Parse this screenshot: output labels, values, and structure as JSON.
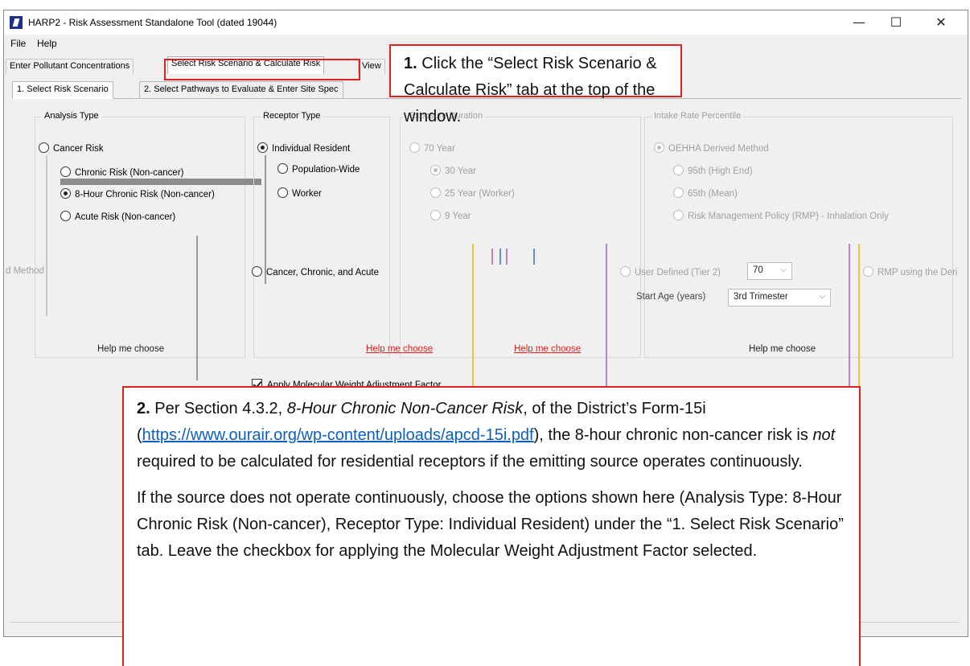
{
  "window": {
    "title": "HARP2 - Risk Assessment Standalone Tool (dated 19044)",
    "minimize": "—",
    "maximize": "☐",
    "close": "✕"
  },
  "menu": [
    "File",
    "Help"
  ],
  "tabs": {
    "enter_pollutant": "Enter Pollutant Concentrations",
    "select_risk": "Select Risk Scenario & Calculate Risk",
    "view": "View"
  },
  "subtabs": {
    "scenario": "1. Select Risk Scenario",
    "pathways": "2. Select Pathways to Evaluate & Enter Site Spec"
  },
  "analysis_type": {
    "title": "Analysis Type",
    "cancer": "Cancer Risk",
    "chronic": "Chronic Risk (Non-cancer)",
    "eight_hour": "8-Hour Chronic Risk (Non-cancer)",
    "acute": "Acute Risk (Non-cancer)",
    "combined": "Cancer, Chronic, and Acute",
    "help": "Help me choose",
    "selected": "8-Hour Chronic Risk (Non-cancer)"
  },
  "receptor_type": {
    "title": "Receptor Type",
    "individual": "Individual Resident",
    "population": "Population-Wide",
    "worker": "Worker",
    "help": "Help me choose",
    "selected": "Individual Resident"
  },
  "exposure_duration": {
    "title": "Exposure Duration",
    "y70": "70 Year",
    "y30": "30 Year",
    "y25": "25 Year (Worker)",
    "y9": "9 Year",
    "help": "Help me choose"
  },
  "intake_rate": {
    "title": "Intake Rate Percentile",
    "oehha": "OEHHA Derived Method",
    "p95": "95th (High End)",
    "p65": "65th (Mean)",
    "rmp": "Risk Management Policy (RMP) - Inhalation Only",
    "user_defined": "User Defined (Tier 2)",
    "user_defined_value": "70",
    "start_age_label": "Start Age (years)",
    "start_age_value": "3rd Trimester",
    "help": "Help me choose",
    "left_fragment": "d Method",
    "rmp_derived": "RMP using the Deri"
  },
  "mwaf": {
    "label": "Apply Molecular Weight Adjustment Factor",
    "checked": true
  },
  "callout1": {
    "num": "1.",
    "text": "Click the “Select Risk Scenario & Calculate Risk” tab at the top of the window."
  },
  "callout2": {
    "num": "2.",
    "p1_a": "Per Section 4.3.2,",
    "p1_italic": "8-Hour Chronic Non-Cancer Risk",
    "p1_b": ", of the District’s Form-15i (",
    "p1_link": "https://www.ourair.org/wp-content/uploads/apcd-15i.pdf",
    "p1_c": "), the 8-hour chronic non-cancer risk is",
    "p1_not": "not",
    "p1_d": "required to be calculated for residential receptors if the emitting source operates continuously.",
    "p2": "If the source does not operate continuously, choose the options shown here (Analysis Type: 8-Hour Chronic Risk (Non-cancer), Receptor Type: Individual Resident) under the “1. Select Risk Scenario” tab. Leave the checkbox for applying the Molecular Weight Adjustment Factor selected."
  },
  "colors": {
    "accent_red": "#e0201c",
    "link_blue": "#0b5fc4",
    "window_bg": "#f0f0f0"
  }
}
